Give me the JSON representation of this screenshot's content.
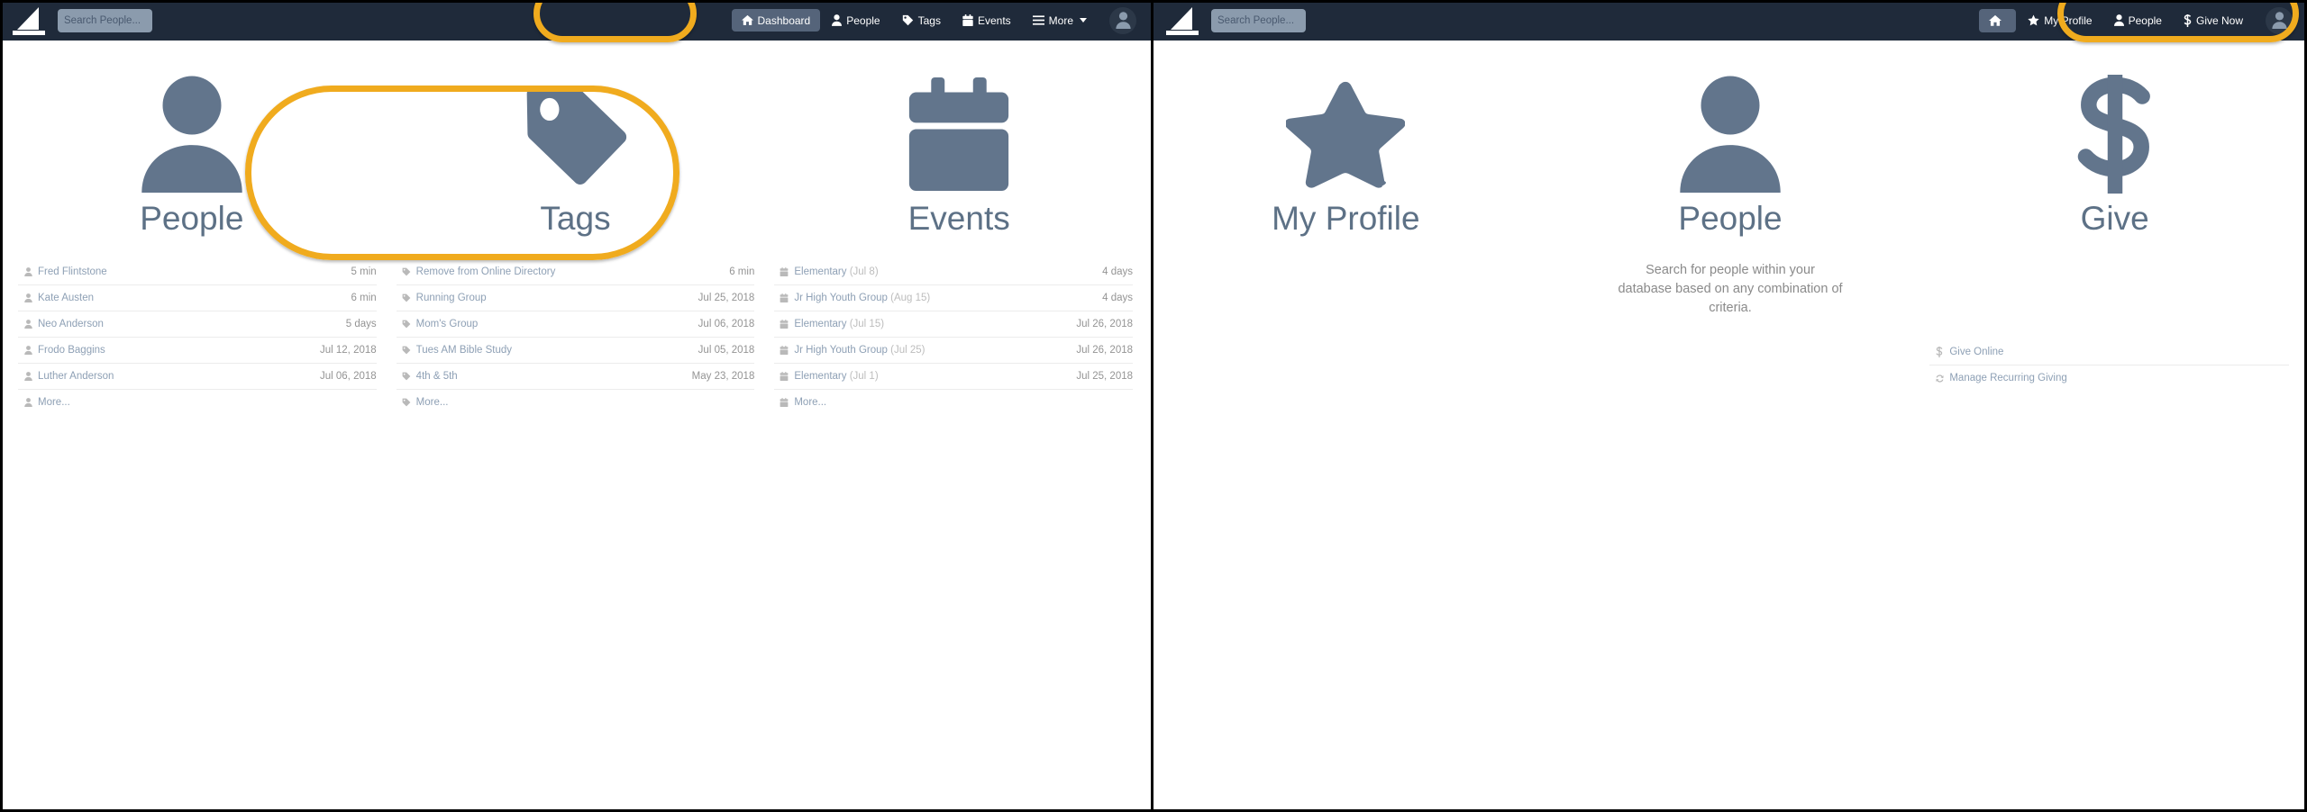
{
  "colors": {
    "navbar_bg": "#1f2a3a",
    "accent_highlight": "#f0ab1e",
    "icon_slate": "#62758c",
    "tile_label": "#5d7186",
    "link_text": "#8ea0b5",
    "meta_text": "#949494",
    "active_pill": "#55647a",
    "search_bg": "#8b9bad"
  },
  "left_panel": {
    "navbar": {
      "logo_name": "sail-logo",
      "search": {
        "placeholder": "Search People...",
        "value": ""
      },
      "items": [
        {
          "label": "Dashboard",
          "icon": "home-icon",
          "active": true
        },
        {
          "label": "People",
          "icon": "person-icon",
          "active": false
        },
        {
          "label": "Tags",
          "icon": "tag-icon",
          "active": false
        },
        {
          "label": "Events",
          "icon": "calendar-icon",
          "active": false
        },
        {
          "label": "More",
          "icon": "hamburger-icon",
          "active": false,
          "caret": true
        }
      ],
      "avatar": "user-avatar"
    },
    "tiles": [
      {
        "label": "People",
        "icon": "person-icon"
      },
      {
        "label": "Tags",
        "icon": "tag-icon"
      },
      {
        "label": "Events",
        "icon": "calendar-icon"
      }
    ],
    "lists": [
      {
        "icon": "person-icon",
        "rows": [
          {
            "label": "Fred Flintstone",
            "sub": "",
            "time": "5 min"
          },
          {
            "label": "Kate Austen",
            "sub": "",
            "time": "6 min"
          },
          {
            "label": "Neo Anderson",
            "sub": "",
            "time": "5 days"
          },
          {
            "label": "Frodo Baggins",
            "sub": "",
            "time": "Jul 12, 2018"
          },
          {
            "label": "Luther Anderson",
            "sub": "",
            "time": "Jul 06, 2018"
          },
          {
            "label": "More...",
            "sub": "",
            "time": ""
          }
        ]
      },
      {
        "icon": "tag-icon",
        "rows": [
          {
            "label": "Remove from Online Directory",
            "sub": "",
            "time": "6 min"
          },
          {
            "label": "Running Group",
            "sub": "",
            "time": "Jul 25, 2018"
          },
          {
            "label": "Mom's Group",
            "sub": "",
            "time": "Jul 06, 2018"
          },
          {
            "label": "Tues AM Bible Study",
            "sub": "",
            "time": "Jul 05, 2018"
          },
          {
            "label": "4th & 5th",
            "sub": "",
            "time": "May 23, 2018"
          },
          {
            "label": "More...",
            "sub": "",
            "time": ""
          }
        ]
      },
      {
        "icon": "calendar-icon",
        "rows": [
          {
            "label": "Elementary",
            "sub": " (Jul 8)",
            "time": "4 days"
          },
          {
            "label": "Jr High Youth Group",
            "sub": " (Aug 15)",
            "time": "4 days"
          },
          {
            "label": "Elementary",
            "sub": " (Jul 15)",
            "time": "Jul 26, 2018"
          },
          {
            "label": "Jr High Youth Group",
            "sub": " (Jul 25)",
            "time": "Jul 26, 2018"
          },
          {
            "label": "Elementary",
            "sub": " (Jul 1)",
            "time": "Jul 25, 2018"
          },
          {
            "label": "More...",
            "sub": "",
            "time": ""
          }
        ]
      }
    ]
  },
  "right_panel": {
    "navbar": {
      "logo_name": "sail-logo",
      "search": {
        "placeholder": "Search People...",
        "value": ""
      },
      "items": [
        {
          "label": "",
          "icon": "home-icon",
          "active": true
        },
        {
          "label": "My Profile",
          "icon": "star-icon",
          "active": false
        },
        {
          "label": "People",
          "icon": "person-icon",
          "active": false
        },
        {
          "label": "Give Now",
          "icon": "dollar-icon",
          "active": false
        }
      ],
      "avatar": "user-avatar"
    },
    "tiles": [
      {
        "label": "My Profile",
        "icon": "star-icon",
        "desc": ""
      },
      {
        "label": "People",
        "icon": "person-icon",
        "desc": "Search for people within your database based on any combination of criteria."
      },
      {
        "label": "Give",
        "icon": "dollar-icon",
        "desc": ""
      }
    ],
    "lists": [
      {
        "icon": "",
        "rows": []
      },
      {
        "icon": "",
        "rows": []
      },
      {
        "icon": "mixed",
        "rows": [
          {
            "label": "Give Online",
            "sub": "",
            "time": "",
            "icon": "dollar-icon"
          },
          {
            "label": "Manage Recurring Giving",
            "sub": "",
            "time": "",
            "icon": "refresh-icon"
          }
        ]
      }
    ]
  }
}
